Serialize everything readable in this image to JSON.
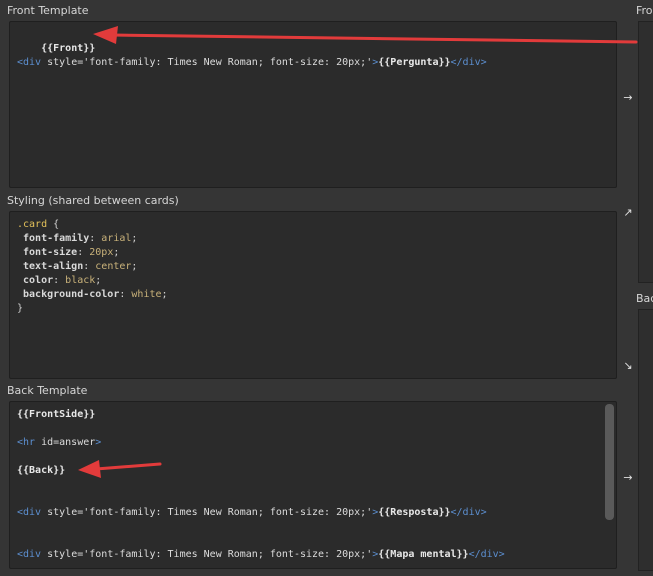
{
  "front": {
    "label": "Front Template",
    "lines": {
      "l1": "{{Front}}",
      "l2_open": "<div",
      "l2_attr": " style='font-family: Times New Roman; font-size: 20px;'",
      "l2_gt": ">",
      "l2_field": "{{Pergunta}}",
      "l2_close": "</div>"
    }
  },
  "styling": {
    "label": "Styling (shared between cards)",
    "lines": {
      "sel": ".card",
      "brace_open": " {",
      "p1": " font-family",
      "v1": " arial",
      "p2": " font-size",
      "v2": " 20px",
      "p3": " text-align",
      "v3": " center",
      "p4": " color",
      "v4": " black",
      "p5": " background-color",
      "v5": " white",
      "colon": ":",
      "semi": ";",
      "brace_close": "}"
    }
  },
  "back": {
    "label": "Back Template",
    "lines": {
      "l1": "{{FrontSide}}",
      "l2_open": "<hr",
      "l2_attr": " id=answer",
      "l2_gt": ">",
      "l3": "{{Back}}",
      "l4_open": "<div",
      "l4_attr": " style='font-family: Times New Roman; font-size: 20px;'",
      "l4_gt": ">",
      "l4_field": "{{Resposta}}",
      "l4_close": "</div>",
      "l5_open": "<div",
      "l5_attr": " style='font-family: Times New Roman; font-size: 20px;'",
      "l5_gt": ">",
      "l5_field": "{{Mapa mental}}",
      "l5_close": "</div>"
    }
  },
  "side": {
    "front_preview_label": "Fro",
    "back_preview_label": "Bac",
    "arrow_right": "→",
    "arrow_up_right": "↗",
    "arrow_down_right": "↘"
  },
  "colors": {
    "background": "#353535",
    "editor_bg": "#2b2b2b",
    "tag": "#5c8fd0",
    "annotation_arrow": "#e23b3b"
  }
}
